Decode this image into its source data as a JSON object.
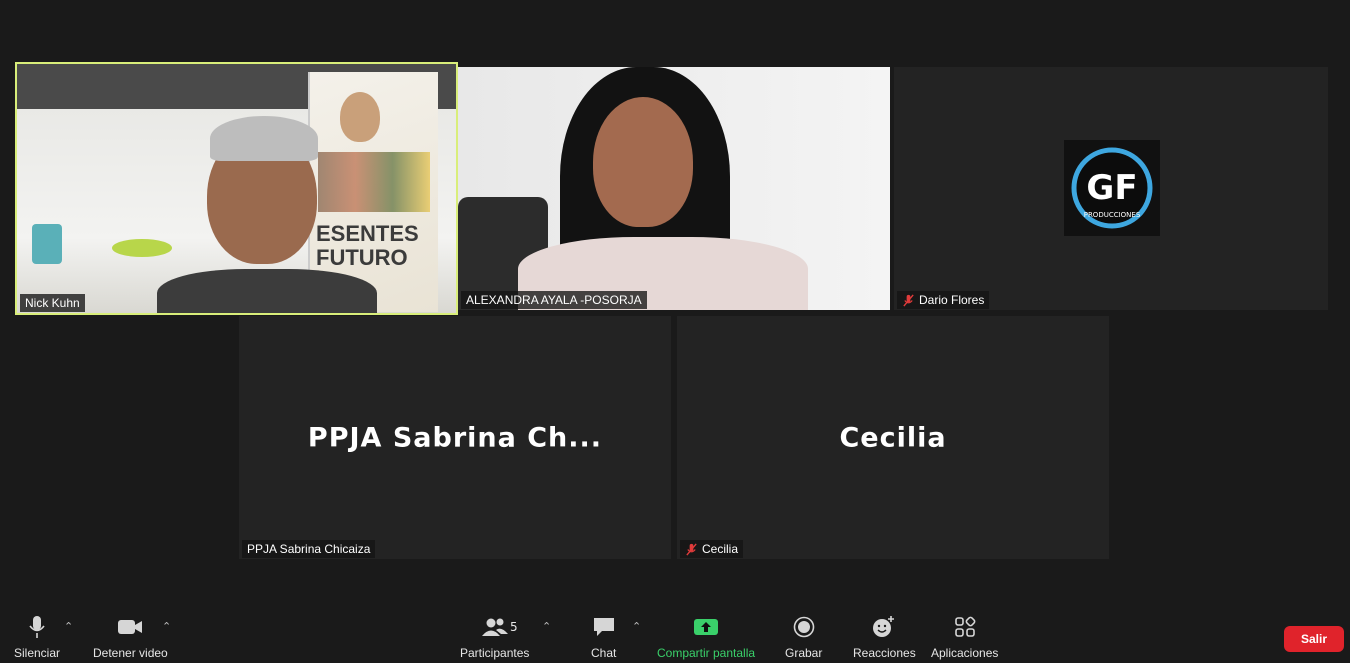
{
  "participants": [
    {
      "name": "Nick Kuhn",
      "muted": false,
      "active": true
    },
    {
      "name": "ALEXANDRA AYALA -POSORJA",
      "muted": false
    },
    {
      "name": "Dario Flores",
      "muted": true
    },
    {
      "name": "PPJA Sabrina Chicaiza",
      "display_name": "PPJA Sabrina Ch...",
      "muted": false
    },
    {
      "name": "Cecilia",
      "display_name": "Cecilia",
      "muted": true
    }
  ],
  "poster_text": [
    "ESENTES",
    "FUTURO"
  ],
  "logo_text": "PRODUCCIONES",
  "toolbar": {
    "mute_label": "Silenciar",
    "video_label": "Detener video",
    "participants_label": "Participantes",
    "participants_count": "5",
    "chat_label": "Chat",
    "share_label": "Compartir pantalla",
    "record_label": "Grabar",
    "reactions_label": "Reacciones",
    "apps_label": "Aplicaciones",
    "leave_label": "Salir"
  },
  "colors": {
    "active_speaker": "#d9ee7a",
    "share_green": "#3ad06a",
    "leave_red": "#e0232b",
    "muted_red": "#e03b3b"
  }
}
